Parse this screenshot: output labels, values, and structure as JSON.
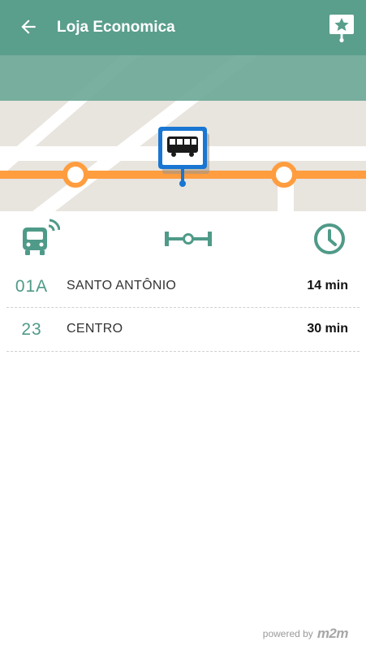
{
  "header": {
    "title": "Loja Economica",
    "back_icon": "arrow-left-icon",
    "favorite_icon": "star-pin-icon",
    "color": "#5a9e8c"
  },
  "map": {
    "route_color": "#ff9d3f",
    "stop_marker_icon": "bus-stop-icon",
    "stop_marker_color": "#1976d2"
  },
  "icons": {
    "left": "bus-signal-icon",
    "center": "route-line-icon",
    "right": "clock-icon",
    "color": "#4f9a88"
  },
  "arrivals": [
    {
      "line": "01A",
      "destination": "SANTO ANTÔNIO",
      "eta": "14 min"
    },
    {
      "line": "23",
      "destination": "CENTRO",
      "eta": "30 min"
    }
  ],
  "footer": {
    "powered_by": "powered by",
    "brand": "m2m"
  }
}
